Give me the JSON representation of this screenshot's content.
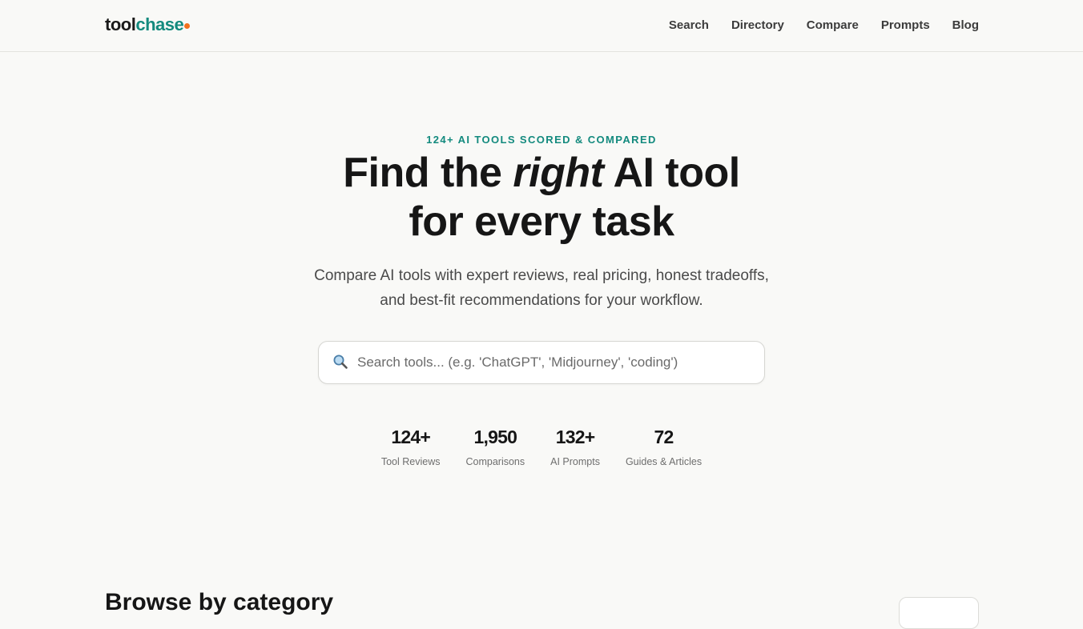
{
  "header": {
    "logo_part1": "tool",
    "logo_part2": "chase",
    "nav": [
      "Search",
      "Directory",
      "Compare",
      "Prompts",
      "Blog"
    ]
  },
  "hero": {
    "eyebrow": "124+ AI TOOLS SCORED & COMPARED",
    "title_before": "Find the ",
    "title_em": "right",
    "title_after": " AI tool",
    "title_line2": "for every task",
    "lede_line1": "Compare AI tools with expert reviews, real pricing, honest tradeoffs,",
    "lede_line2": "and best-fit recommendations for your workflow."
  },
  "search": {
    "placeholder": "Search tools... (e.g. 'ChatGPT', 'Midjourney', 'coding')",
    "icon": "search-icon"
  },
  "stats": [
    {
      "value": "124+",
      "label": "Tool Reviews"
    },
    {
      "value": "1,950",
      "label": "Comparisons"
    },
    {
      "value": "132+",
      "label": "AI Prompts"
    },
    {
      "value": "72",
      "label": "Guides & Articles"
    }
  ],
  "browse": {
    "heading": "Browse by category"
  },
  "colors": {
    "accent": "#138a7e",
    "logo_dot": "#f2701d",
    "background": "#f9f9f7"
  }
}
